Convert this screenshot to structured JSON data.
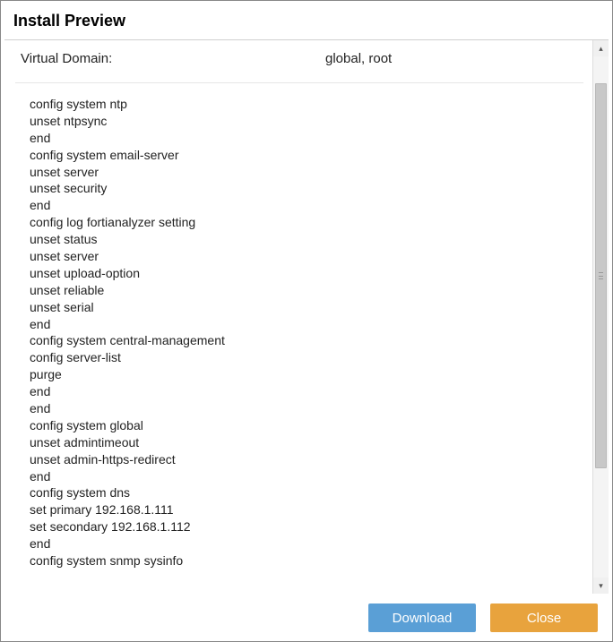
{
  "dialog": {
    "title": "Install Preview"
  },
  "vd": {
    "label": "Virtual Domain:",
    "value": "global, root"
  },
  "config_lines": [
    "config system ntp",
    "unset ntpsync",
    "end",
    "config system email-server",
    "unset server",
    "unset security",
    "end",
    "config log fortianalyzer setting",
    "unset status",
    "unset server",
    "unset upload-option",
    "unset reliable",
    "unset serial",
    "end",
    "config system central-management",
    "config server-list",
    "purge",
    "end",
    "end",
    "config system global",
    "unset admintimeout",
    "unset admin-https-redirect",
    "end",
    "config system dns",
    "set primary 192.168.1.111",
    "set secondary 192.168.1.112",
    "end",
    "config system snmp sysinfo"
  ],
  "buttons": {
    "download": "Download",
    "close": "Close"
  },
  "config_text": "config system ntp\nunset ntpsync\nend\nconfig system email-server\nunset server\nunset security\nend\nconfig log fortianalyzer setting\nunset status\nunset server\nunset upload-option\nunset reliable\nunset serial\nend\nconfig system central-management\nconfig server-list\npurge\nend\nend\nconfig system global\nunset admintimeout\nunset admin-https-redirect\nend\nconfig system dns\nset primary 192.168.1.111\nset secondary 192.168.1.112\nend\nconfig system snmp sysinfo"
}
